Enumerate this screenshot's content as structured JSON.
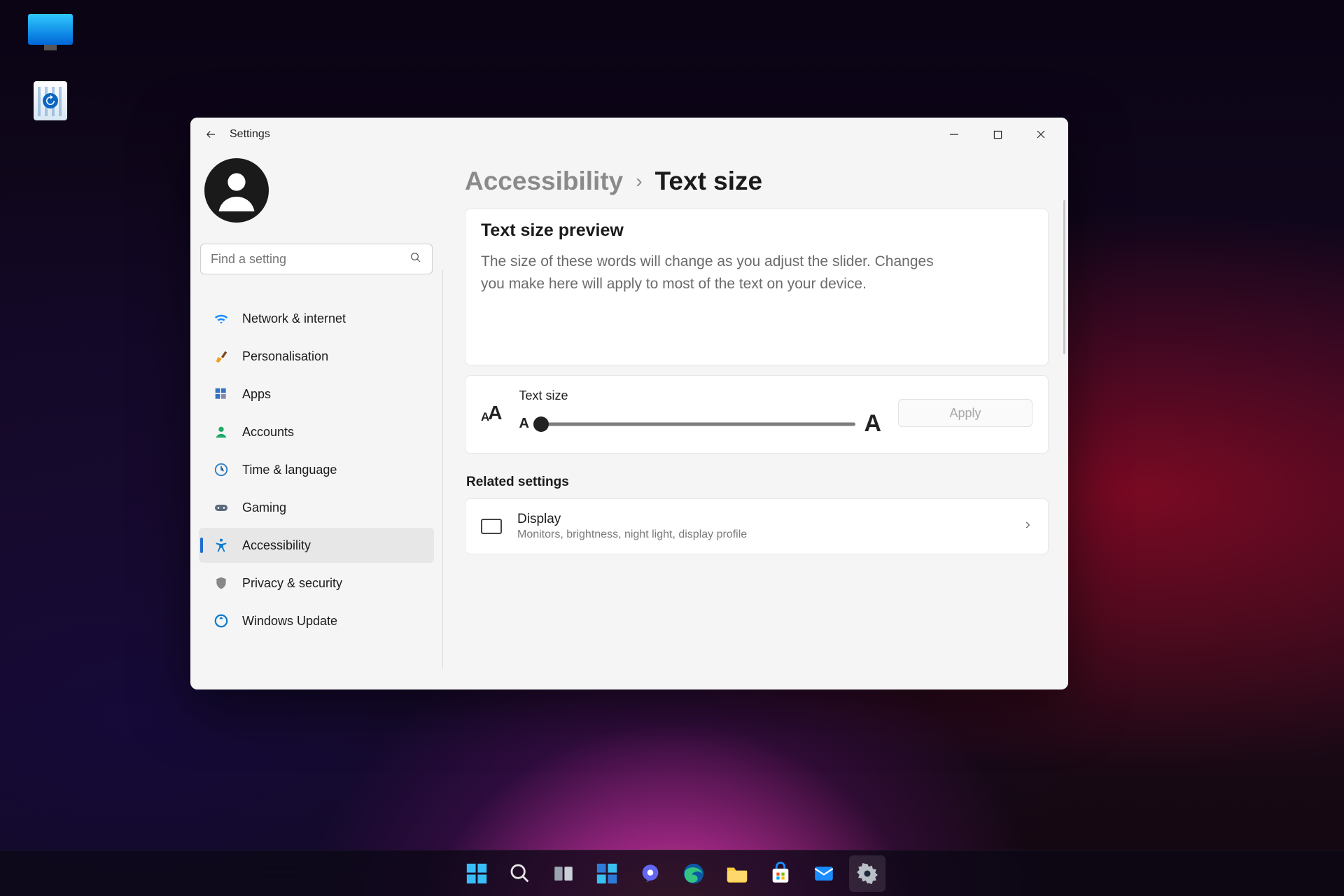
{
  "window": {
    "app_title": "Settings"
  },
  "sidebar": {
    "search_placeholder": "Find a setting",
    "items": [
      {
        "label": "Network & internet"
      },
      {
        "label": "Personalisation"
      },
      {
        "label": "Apps"
      },
      {
        "label": "Accounts"
      },
      {
        "label": "Time & language"
      },
      {
        "label": "Gaming"
      },
      {
        "label": "Accessibility"
      },
      {
        "label": "Privacy & security"
      },
      {
        "label": "Windows Update"
      }
    ]
  },
  "breadcrumb": {
    "root": "Accessibility",
    "leaf": "Text size"
  },
  "preview": {
    "heading": "Text size preview",
    "body": "The size of these words will change as you adjust the slider. Changes you make here will apply to most of the text on your device."
  },
  "slider": {
    "label": "Text size",
    "apply": "Apply"
  },
  "related": {
    "header": "Related settings",
    "display": {
      "title": "Display",
      "subtitle": "Monitors, brightness, night light, display profile"
    }
  }
}
